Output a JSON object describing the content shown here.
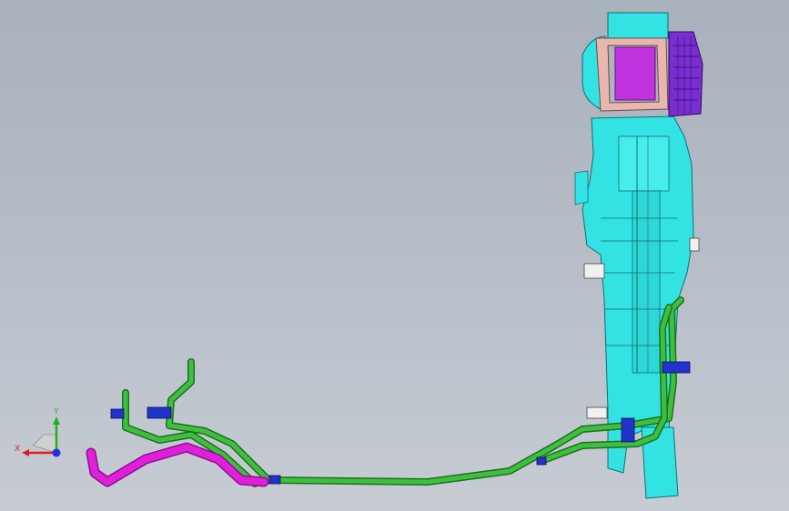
{
  "viewport": {
    "background_top": "#a9b1bc",
    "background_bottom": "#c7ccd3"
  },
  "model": {
    "parts": [
      {
        "name": "hvac-housing",
        "color": "#33e3e3"
      },
      {
        "name": "blower-filter-box",
        "color": "#c233e0"
      },
      {
        "name": "blower-motor-housing",
        "color": "#7a2ed1"
      },
      {
        "name": "frame-gasket",
        "color": "#e8b8b0"
      },
      {
        "name": "green-pipes",
        "color": "#2a9a2a"
      },
      {
        "name": "magenta-drain-hose",
        "color": "#e020d8"
      },
      {
        "name": "pipe-clips",
        "color": "#2233cc"
      }
    ]
  },
  "triad": {
    "x_label": "X",
    "y_label": "Y",
    "x_color": "#e02020",
    "y_color": "#20b020",
    "z_color": "#2030e0"
  }
}
